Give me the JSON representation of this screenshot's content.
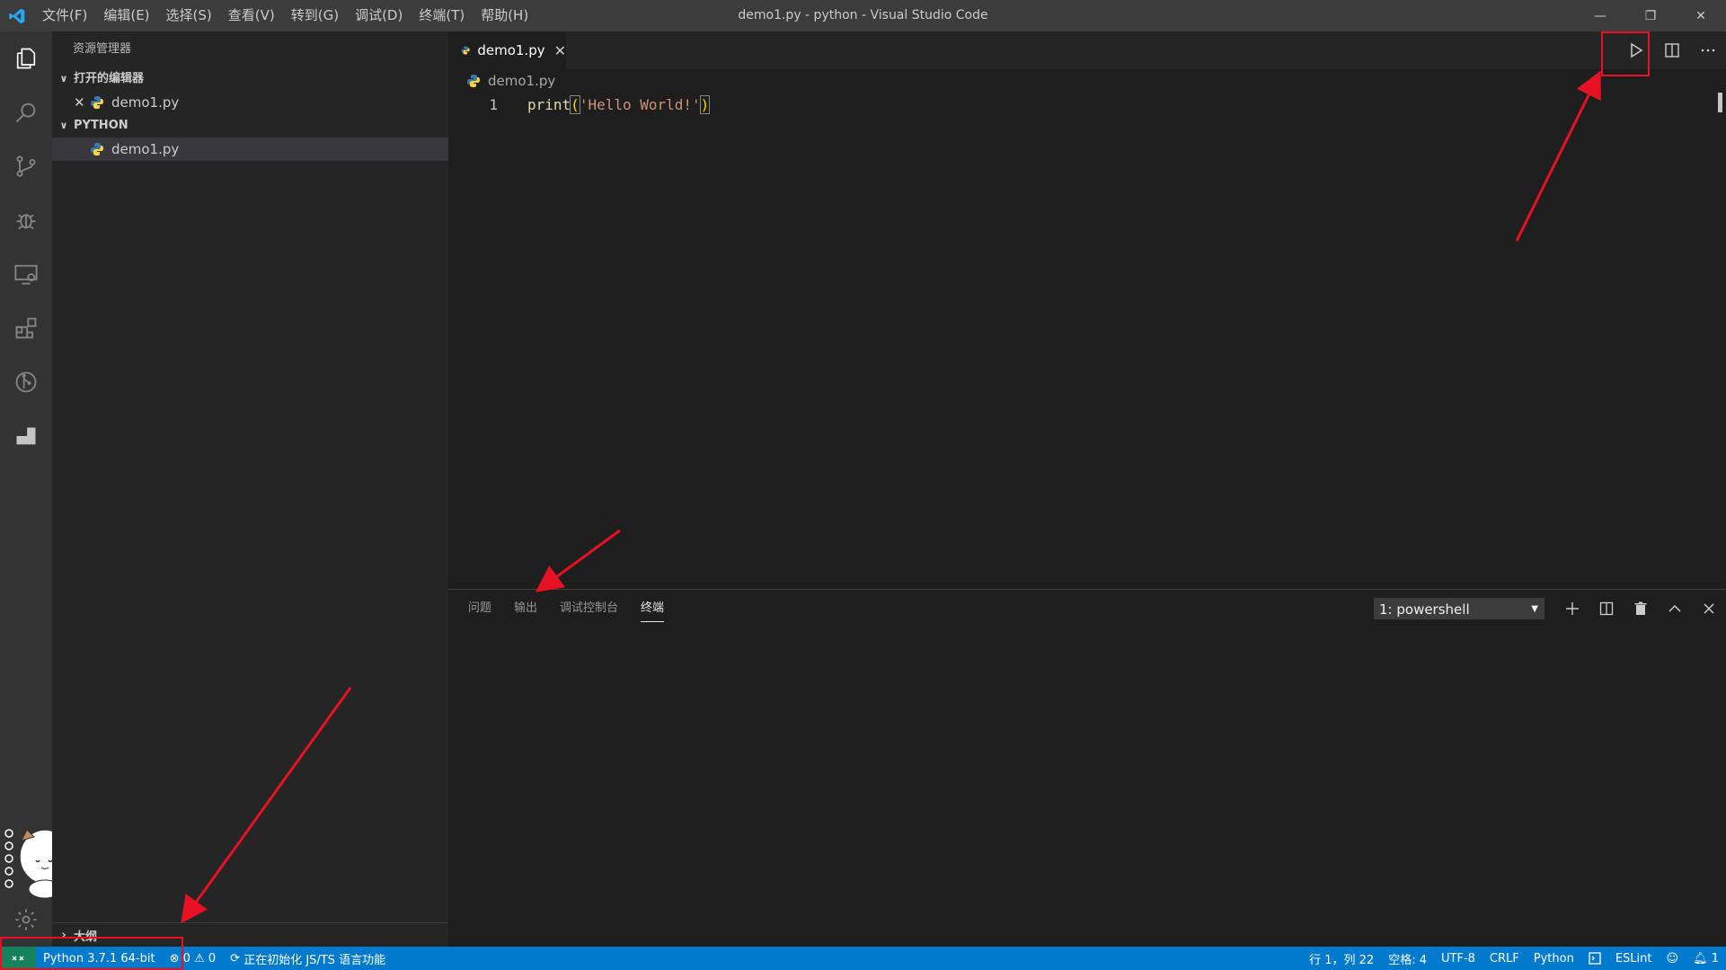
{
  "window": {
    "title": "demo1.py - python - Visual Studio Code",
    "menu": [
      "文件(F)",
      "编辑(E)",
      "选择(S)",
      "查看(V)",
      "转到(G)",
      "调试(D)",
      "终端(T)",
      "帮助(H)"
    ],
    "controls": {
      "minimize": "—",
      "restore": "❐",
      "close": "✕"
    }
  },
  "activity_bar": [
    "explorer-icon",
    "search-icon",
    "source-control-icon",
    "debug-icon",
    "remote-explorer-icon",
    "extensions-icon",
    "git-history-icon",
    "docker-icon"
  ],
  "sidebar": {
    "title": "资源管理器",
    "open_editors": {
      "label": "打开的编辑器",
      "files": [
        "demo1.py"
      ]
    },
    "folder": {
      "label": "PYTHON",
      "files": [
        "demo1.py"
      ]
    },
    "outline": "大纲"
  },
  "editor": {
    "tab": {
      "label": "demo1.py",
      "close": "✕"
    },
    "breadcrumb": "demo1.py",
    "lines": [
      {
        "number": "1",
        "tokens": [
          "print",
          "(",
          "'Hello World!'",
          ")"
        ]
      }
    ]
  },
  "panel": {
    "tabs": [
      "问题",
      "输出",
      "调试控制台",
      "终端"
    ],
    "active_tab": "终端",
    "terminal_select": "1: powershell"
  },
  "status_bar": {
    "interpreter": "Python 3.7.1 64-bit",
    "errors": "0",
    "warnings": "0",
    "task": "正在初始化 JS/TS 语言功能",
    "position": "行 1，列 22",
    "spaces": "空格: 4",
    "encoding": "UTF-8",
    "eol": "CRLF",
    "language": "Python",
    "eslint": "ESLint",
    "notifications": "1"
  },
  "colors": {
    "statusbar": "#007acc",
    "titlebar": "#3c3c3c",
    "activity": "#333333",
    "sidebar": "#252526",
    "editor": "#1e1e1e",
    "annotation": "#e81123"
  }
}
